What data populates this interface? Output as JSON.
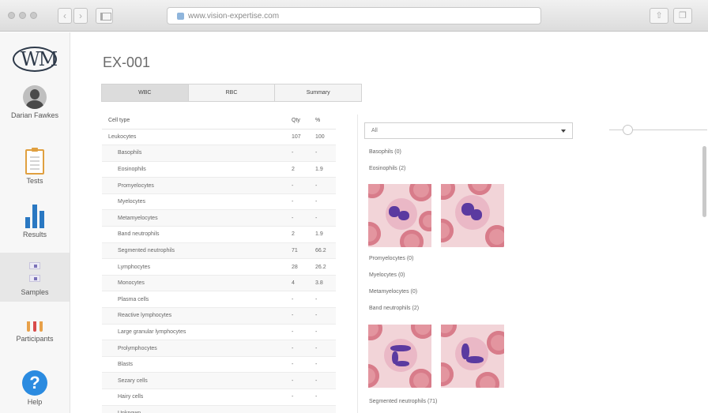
{
  "browser": {
    "url": "www.vision-expertise.com"
  },
  "sidebar": {
    "logo": "WM",
    "user": "Darian Fawkes",
    "items": [
      {
        "label": "Tests",
        "icon": "clipboard-icon"
      },
      {
        "label": "Results",
        "icon": "bar-chart-icon"
      },
      {
        "label": "Samples",
        "icon": "slides-icon"
      },
      {
        "label": "Participants",
        "icon": "tubes-icon"
      },
      {
        "label": "Help",
        "icon": "help-icon"
      }
    ],
    "active": "Samples"
  },
  "page": {
    "title": "EX-001"
  },
  "tabs": [
    "WBC",
    "RBC",
    "Summary"
  ],
  "table": {
    "headers": [
      "Cell type",
      "Qty",
      "%"
    ],
    "rows": [
      {
        "name": "Leukocytes",
        "qty": "107",
        "pct": "100"
      },
      {
        "name": "Basophils",
        "qty": "-",
        "pct": "-"
      },
      {
        "name": "Eosinophils",
        "qty": "2",
        "pct": "1.9"
      },
      {
        "name": "Promyelocytes",
        "qty": "-",
        "pct": "-"
      },
      {
        "name": "Myelocytes",
        "qty": "-",
        "pct": "-"
      },
      {
        "name": "Metamyelocytes",
        "qty": "-",
        "pct": "-"
      },
      {
        "name": "Band neutrophils",
        "qty": "2",
        "pct": "1.9"
      },
      {
        "name": "Segmented neutrophils",
        "qty": "71",
        "pct": "66.2"
      },
      {
        "name": "Lymphocytes",
        "qty": "28",
        "pct": "26.2"
      },
      {
        "name": "Monocytes",
        "qty": "4",
        "pct": "3.8"
      },
      {
        "name": "Plasma cells",
        "qty": "-",
        "pct": "-"
      },
      {
        "name": "Reactive lymphocytes",
        "qty": "-",
        "pct": "-"
      },
      {
        "name": "Large granular lymphocytes",
        "qty": "-",
        "pct": "-"
      },
      {
        "name": "Prolymphocytes",
        "qty": "-",
        "pct": "-"
      },
      {
        "name": "Blasts",
        "qty": "-",
        "pct": "-"
      },
      {
        "name": "Sezary cells",
        "qty": "-",
        "pct": "-"
      },
      {
        "name": "Hairy cells",
        "qty": "-",
        "pct": "-"
      },
      {
        "name": "Unknown",
        "qty": "",
        "pct": ""
      }
    ]
  },
  "gallery": {
    "filter": "All",
    "groups": [
      "Basophils (0)",
      "Eosinophils (2)",
      "Promyelocytes (0)",
      "Myelocytes (0)",
      "Metamyelocytes (0)",
      "Band neutrophils (2)",
      "Segmented neutrophils (71)"
    ]
  }
}
